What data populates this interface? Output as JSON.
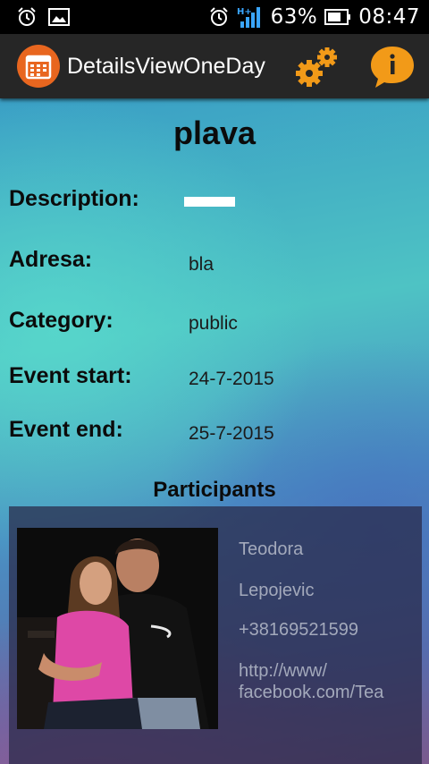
{
  "status_bar": {
    "battery_percent": "63%",
    "time": "08:47",
    "left_icons": [
      "alarm-icon",
      "image-icon"
    ],
    "right_icons": [
      "alarm-icon",
      "signal-icon",
      "battery-icon"
    ]
  },
  "action_bar": {
    "title": "DetailsViewOneDay",
    "app_icon": "calendar-icon",
    "actions": [
      "settings-gears-icon",
      "info-icon"
    ],
    "accent_color": "#e8661f",
    "info_color": "#f29a18"
  },
  "event": {
    "title": "plava",
    "rows": [
      {
        "label": "Description:",
        "value": ""
      },
      {
        "label": "Adresa:",
        "value": "bla"
      },
      {
        "label": "Category:",
        "value": "public"
      },
      {
        "label": "Event start:",
        "value": "24-7-2015"
      },
      {
        "label": "Event end:",
        "value": "25-7-2015"
      }
    ]
  },
  "participants": {
    "title": "Participants",
    "items": [
      {
        "first_name": "Teodora",
        "last_name": "Lepojevic",
        "phone": "+38169521599",
        "link_line1": "http://www/",
        "link_line2": "facebook.com/Tea"
      }
    ]
  }
}
